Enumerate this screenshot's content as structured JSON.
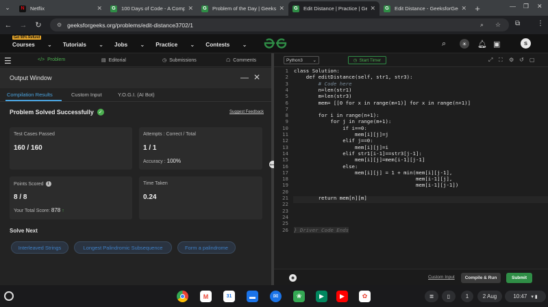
{
  "browser": {
    "tabs": [
      {
        "title": "Netflix",
        "fav": "N",
        "fav_bg": "#111111",
        "fav_color": "#e50914"
      },
      {
        "title": "100 Days of Code - A Comp",
        "fav": "G",
        "fav_bg": "#2f8d46",
        "fav_color": "#ffffff"
      },
      {
        "title": "Problem of the Day | Geeksfo",
        "fav": "G",
        "fav_bg": "#2f8d46",
        "fav_color": "#ffffff"
      },
      {
        "title": "Edit Distance | Practice | Geek",
        "fav": "G",
        "fav_bg": "#2f8d46",
        "fav_color": "#ffffff"
      },
      {
        "title": "Edit Distance - GeeksforGeeks",
        "fav": "G",
        "fav_bg": "#2f8d46",
        "fav_color": "#ffffff"
      }
    ],
    "url": "geeksforgeeks.org/problems/edit-distance3702/1"
  },
  "gfg_header": {
    "refund_badge": "Get 90% Refund",
    "nav": [
      "Courses",
      "Tutorials",
      "Jobs",
      "Practice",
      "Contests"
    ],
    "logo": "ƒƒ",
    "avatar_letter": "S"
  },
  "problem_nav": {
    "items": [
      "Problem",
      "Editorial",
      "Submissions",
      "Comments"
    ]
  },
  "output": {
    "title": "Output Window",
    "tabs": [
      "Compilation Results",
      "Custom Input",
      "Y.O.G.I. (AI Bot)"
    ],
    "status": "Problem Solved Successfully",
    "feedback": "Suggest Feedback",
    "test_cases_label": "Test Cases Passed",
    "test_cases_value": "160 / 160",
    "attempts_label": "Attempts : Correct / Total",
    "attempts_value": "1 / 1",
    "accuracy_label": "Accuracy :",
    "accuracy_value": "100%",
    "points_label": "Points Scored",
    "points_value": "8 / 8",
    "total_score_label": "Your Total Score:",
    "total_score_value": "878",
    "time_label": "Time Taken",
    "time_value": "0.24",
    "solve_next_label": "Solve Next",
    "solve_next": [
      "Interleaved Strings",
      "Longest Palindromic Subsequence",
      "Form a palindrome"
    ]
  },
  "editor": {
    "language": "Python3",
    "timer": "Start Timer",
    "lines": [
      {
        "n": "1",
        "code": "class Solution:"
      },
      {
        "n": "2",
        "code": "    def editDistance(self, str1, str3):"
      },
      {
        "n": "3",
        "code": "        # Code here"
      },
      {
        "n": "4",
        "code": "        n=len(str1)"
      },
      {
        "n": "5",
        "code": "        m=len(str3)"
      },
      {
        "n": "6",
        "code": "        mem= [[0 for x in range(m+1)] for x in range(n+1)]"
      },
      {
        "n": "7",
        "code": ""
      },
      {
        "n": "8",
        "code": "        for i in range(n+1):"
      },
      {
        "n": "9",
        "code": "            for j in range(m+1):"
      },
      {
        "n": "10",
        "code": "                if i==0:"
      },
      {
        "n": "11",
        "code": "                    mem[i][j]=j"
      },
      {
        "n": "12",
        "code": "                elif j==0:"
      },
      {
        "n": "13",
        "code": "                    mem[i][j]=i"
      },
      {
        "n": "14",
        "code": "                elif str1[i-1]==str3[j-1]:"
      },
      {
        "n": "15",
        "code": "                    mem[i][j]=mem[i-1][j-1]"
      },
      {
        "n": "16",
        "code": "                else:"
      },
      {
        "n": "17",
        "code": "                    mem[i][j] = 1 + min(mem[i][j-1],"
      },
      {
        "n": "18",
        "code": "                                        mem[i-1][j],"
      },
      {
        "n": "19",
        "code": "                                        mem[i-1][j-1])"
      },
      {
        "n": "20",
        "code": ""
      },
      {
        "n": "21",
        "code": "        return mem[n][m]"
      },
      {
        "n": "22",
        "code": ""
      },
      {
        "n": "23",
        "code": ""
      },
      {
        "n": "24",
        "code": ""
      },
      {
        "n": "25",
        "code": ""
      },
      {
        "n": "26",
        "code": "} Driver Code Ends"
      }
    ],
    "custom_input": "Custom Input",
    "compile_run": "Compile & Run",
    "submit": "Submit"
  },
  "taskbar": {
    "date": "2 Aug",
    "time": "10:47",
    "notif_count": "1"
  },
  "colors": {
    "accent_green": "#2f8d46",
    "link_blue": "#4aa3df"
  }
}
